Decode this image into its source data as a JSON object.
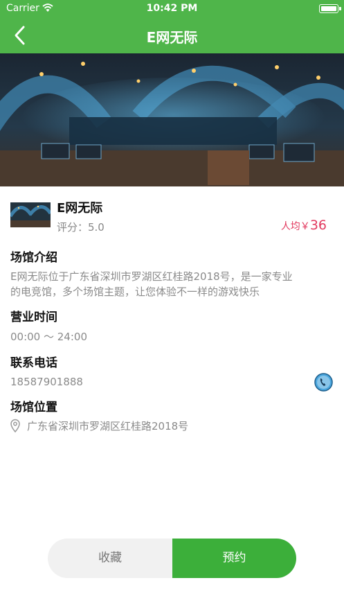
{
  "status_bar": {
    "carrier": "Carrier",
    "time": "10:42 PM"
  },
  "nav": {
    "title": "E网无际",
    "back_icon": "chevron-left-icon"
  },
  "venue": {
    "name": "E网无际",
    "rating": "评分：5.0",
    "price_label": "人均￥",
    "price_value": "36"
  },
  "sections": {
    "intro_title": "场馆介绍",
    "intro_line1": "E网无际位于广东省深圳市罗湖区红桂路2018号，是一家专业",
    "intro_line2": "的电竞馆，多个场馆主题，让您体验不一样的游戏快乐",
    "hours_title": "营业时间",
    "hours_text": "00:00 ～ 24:00",
    "phone_title": "联系电话",
    "phone_text": "18587901888",
    "location_title": "场馆位置",
    "location_text": "广东省深圳市罗湖区红桂路2018号"
  },
  "buttons": {
    "favorite": "收藏",
    "book": "预约"
  },
  "colors": {
    "brand_green": "#4fb54a",
    "book_green": "#3caf3a",
    "price_red": "#e23a5f"
  }
}
